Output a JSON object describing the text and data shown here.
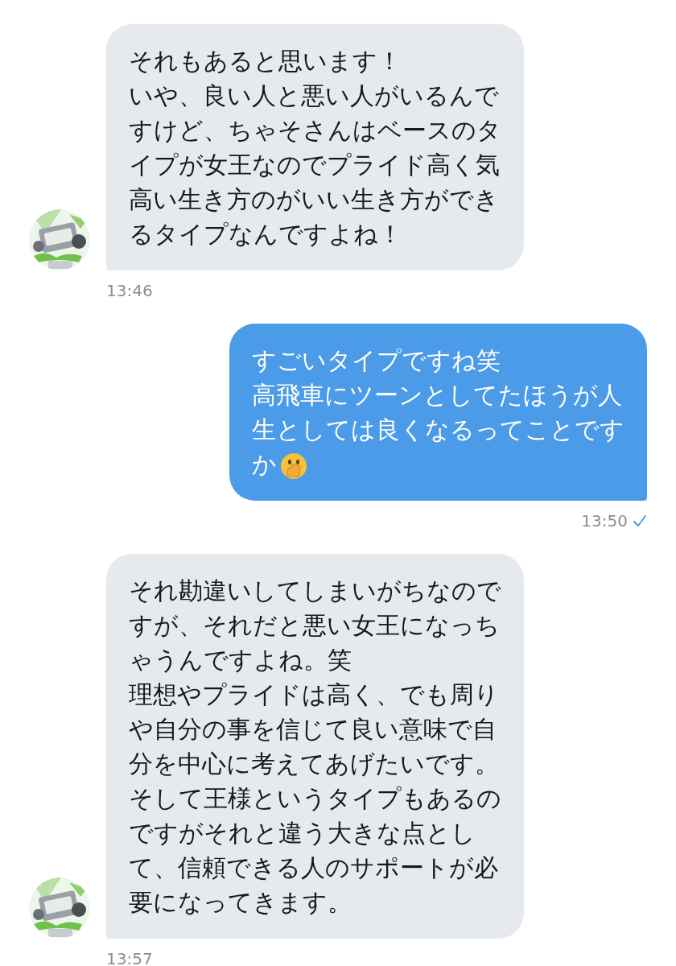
{
  "messages": [
    {
      "kind": "received",
      "lines": [
        "それもあると思います！",
        "いや、良い人と悪い人がいるんで",
        "すけど、ちゃそさんはベースのタ",
        "イプが女王なのでプライド高く気",
        "高い生き方のがいい生き方ができ",
        "るタイプなんですよね！"
      ],
      "time": "13:46"
    },
    {
      "kind": "sent",
      "lines": [
        "すごいタイプですね笑",
        "高飛車にツーンとしてたほうが人",
        "生としては良くなるってことです",
        "か"
      ],
      "emoji": true,
      "time": "13:50",
      "delivered": true
    },
    {
      "kind": "received",
      "lines": [
        "それ勘違いしてしまいがちなので",
        "すが、それだと悪い女王になっち",
        "ゃうんですよね。笑",
        "理想やプライドは高く、でも周り",
        "や自分の事を信じて良い意味で自",
        "分を中心に考えてあげたいです。",
        "そして王様というタイプもあるの",
        "ですがそれと違う大きな点とし",
        "て、信頼できる人のサポートが必",
        "要になってきます。"
      ],
      "time": "13:57"
    }
  ]
}
